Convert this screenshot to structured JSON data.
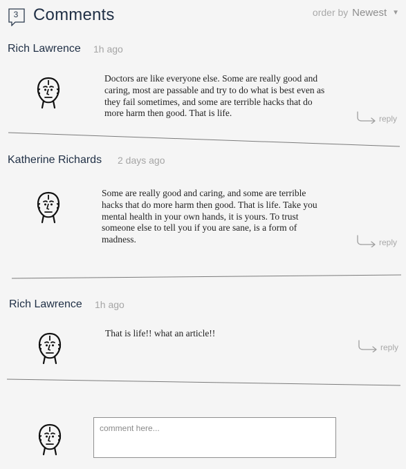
{
  "header": {
    "count": "3",
    "title": "Comments",
    "order_label": "order by",
    "order_value": "Newest"
  },
  "comments": [
    {
      "author": "Rich Lawrence",
      "time": "1h ago",
      "text": "Doctors are like everyone else. Some are really good and caring, most are passable and try to do what is best even as they fail sometimes, and some are terrible hacks that do more harm then good. That is life.",
      "reply_label": "reply"
    },
    {
      "author": "Katherine Richards",
      "time": "2 days ago",
      "text": "Some are really good and caring, and some are terrible hacks that do more harm then good. That is life. Take you mental health in your own hands, it is yours. To trust someone else to tell you if you are sane, is a form of madness.",
      "reply_label": "reply"
    },
    {
      "author": "Rich Lawrence",
      "time": "1h ago",
      "text": "That is life!! what an article!!",
      "reply_label": "reply"
    }
  ],
  "composer": {
    "placeholder": "comment here...",
    "value": ""
  },
  "icons": {
    "count_badge": "speech-bubble-icon",
    "avatar": "face-avatar-icon",
    "reply": "reply-arrow-icon",
    "order_dropdown": "chevron-down-icon"
  },
  "colors": {
    "background": "#f5f5f5",
    "title": "#1f2f45",
    "muted": "#a5a5a5",
    "divider": "#7a7a7a"
  }
}
